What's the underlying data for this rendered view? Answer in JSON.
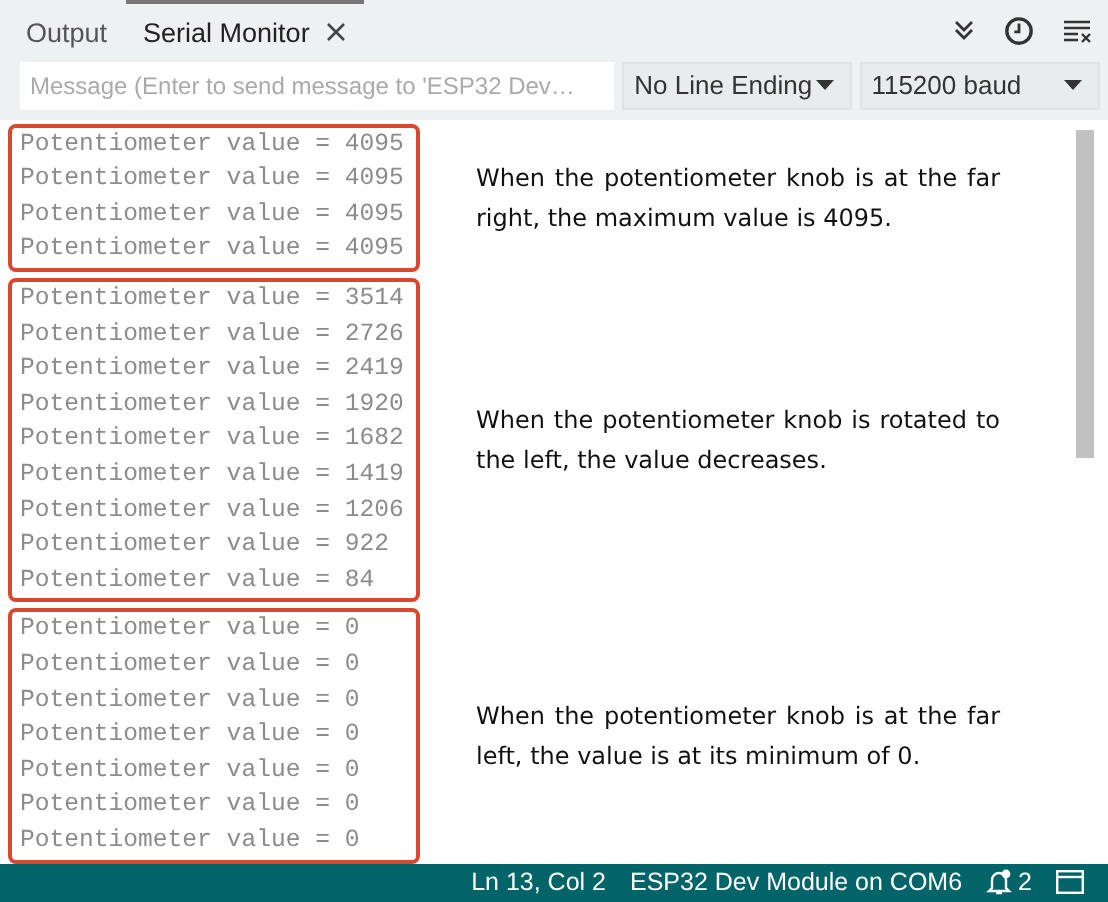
{
  "tabs": [
    {
      "label": "Output",
      "selected": false,
      "closable": false
    },
    {
      "label": "Serial Monitor",
      "selected": true,
      "closable": true
    }
  ],
  "toolbar": {
    "message_field": {
      "placeholder": "Message (Enter to send message to 'ESP32 Dev…"
    },
    "line_ending": "No Line Ending",
    "baud_rate": "115200 baud"
  },
  "output_groups": [
    {
      "lines": [
        "Potentiometer value = 4095",
        "Potentiometer value = 4095",
        "Potentiometer value = 4095",
        "Potentiometer value = 4095"
      ],
      "note": "When the potentiometer knob is at the far right, the maximum value is 4095."
    },
    {
      "lines": [
        "Potentiometer value = 3514",
        "Potentiometer value = 2726",
        "Potentiometer value = 2419",
        "Potentiometer value = 1920",
        "Potentiometer value = 1682",
        "Potentiometer value = 1419",
        "Potentiometer value = 1206",
        "Potentiometer value = 922",
        "Potentiometer value = 84"
      ],
      "note": "When the potentiometer knob is rotated to the left, the value decreases."
    },
    {
      "lines": [
        "Potentiometer value = 0",
        "Potentiometer value = 0",
        "Potentiometer value = 0",
        "Potentiometer value = 0",
        "Potentiometer value = 0",
        "Potentiometer value = 0",
        "Potentiometer value = 0"
      ],
      "note": "When the potentiometer knob is at the far left, the value is at its minimum of 0."
    }
  ],
  "status_bar": {
    "position": "Ln 13, Col 2",
    "board": "ESP32 Dev Module on COM6",
    "notifications": "2"
  }
}
